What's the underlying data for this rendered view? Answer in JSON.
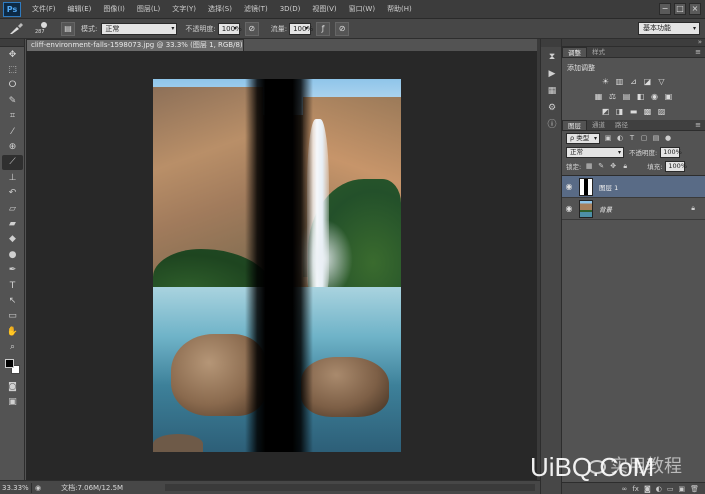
{
  "app": {
    "logo": "Ps",
    "menu": [
      "文件(F)",
      "编辑(E)",
      "图像(I)",
      "图层(L)",
      "文字(Y)",
      "选择(S)",
      "滤镜(T)",
      "3D(D)",
      "视图(V)",
      "窗口(W)",
      "帮助(H)"
    ],
    "window_controls": [
      "−",
      "□",
      "×"
    ]
  },
  "options": {
    "brush_size": "287",
    "mode_label": "模式:",
    "mode_value": "正常",
    "opacity_label": "不透明度:",
    "opacity_value": "100%",
    "flow_label": "流量:",
    "flow_value": "100%",
    "workspace": "基本功能"
  },
  "document": {
    "tab_title": "cliff-environment-falls-1598073.jpg @ 33.3% (图层 1, RGB/8) *",
    "tab_close": "×"
  },
  "status": {
    "zoom": "33.33%",
    "doc_info": "文档:7.06M/12.5M"
  },
  "adjustments": {
    "tabs": [
      "调整",
      "样式"
    ],
    "title": "添加调整"
  },
  "layers": {
    "tabs": [
      "图层",
      "通道",
      "路径"
    ],
    "filter_kind": "ρ 类型",
    "blend_mode": "正常",
    "opacity_label": "不透明度:",
    "opacity_value": "100%",
    "lock_label": "锁定:",
    "fill_label": "填充:",
    "fill_value": "100%",
    "items": [
      {
        "name": "图层 1",
        "selected": true
      },
      {
        "name": "背景",
        "selected": false
      }
    ]
  },
  "watermark": {
    "site": "UiBQ.CoM",
    "text": "实用教程"
  },
  "colors": {
    "foreground": "#000000",
    "background": "#ffffff",
    "selected_layer": "#596b86"
  }
}
